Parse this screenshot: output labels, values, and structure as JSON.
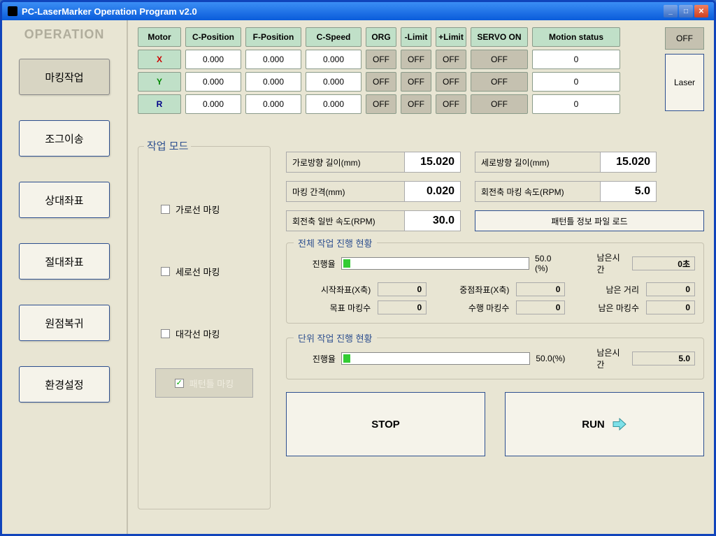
{
  "title": "PC-LaserMarker Operation Program v2.0",
  "sidebar": {
    "title": "OPERATION",
    "items": [
      "마킹작업",
      "조그이송",
      "상대좌표",
      "절대좌표",
      "원점복귀",
      "환경설정"
    ]
  },
  "motor": {
    "headers": [
      "Motor",
      "C-Position",
      "F-Position",
      "C-Speed",
      "ORG",
      "-Limit",
      "+Limit",
      "SERVO ON",
      "Motion status"
    ],
    "rows": [
      {
        "axis": "X",
        "cpos": "0.000",
        "fpos": "0.000",
        "cspeed": "0.000",
        "org": "OFF",
        "nlim": "OFF",
        "plim": "OFF",
        "servo": "OFF",
        "status": "0"
      },
      {
        "axis": "Y",
        "cpos": "0.000",
        "fpos": "0.000",
        "cspeed": "0.000",
        "org": "OFF",
        "nlim": "OFF",
        "plim": "OFF",
        "servo": "OFF",
        "status": "0"
      },
      {
        "axis": "R",
        "cpos": "0.000",
        "fpos": "0.000",
        "cspeed": "0.000",
        "org": "OFF",
        "nlim": "OFF",
        "plim": "OFF",
        "servo": "OFF",
        "status": "0"
      }
    ]
  },
  "side": {
    "off": "OFF",
    "laser": "Laser"
  },
  "workmode": {
    "title": "작업 모드",
    "opts": [
      "가로선 마킹",
      "세로선 마킹",
      "대각선 마킹"
    ],
    "pattern": "패턴틀 마킹"
  },
  "params": {
    "hlen_l": "가로방향 길이(mm)",
    "hlen_v": "15.020",
    "vlen_l": "세로방향 길이(mm)",
    "vlen_v": "15.020",
    "gap_l": "마킹 간격(mm)",
    "gap_v": "0.020",
    "rpm_mark_l": "회전축 마킹 속도(RPM)",
    "rpm_mark_v": "5.0",
    "rpm_gen_l": "회전축 일반 속도(RPM)",
    "rpm_gen_v": "30.0",
    "load_btn": "패턴틀 정보 파일 로드"
  },
  "total": {
    "title": "전체 작업 진행 현황",
    "prog_l": "진행율",
    "pct": "50.0 (%)",
    "remain_l": "남은시간",
    "remain_v": "0초",
    "sx_l": "시작좌표(X축)",
    "sx_v": "0",
    "mx_l": "중점좌표(X축)",
    "mx_v": "0",
    "rd_l": "남은 거리",
    "rd_v": "0",
    "tm_l": "목표 마킹수",
    "tm_v": "0",
    "cm_l": "수행 마킹수",
    "cm_v": "0",
    "rm_l": "남은 마킹수",
    "rm_v": "0"
  },
  "unit": {
    "title": "단위 작업 진행 현황",
    "prog_l": "진행율",
    "pct": "50.0(%)",
    "remain_l": "남은시간",
    "remain_v": "5.0"
  },
  "actions": {
    "stop": "STOP",
    "run": "RUN"
  }
}
